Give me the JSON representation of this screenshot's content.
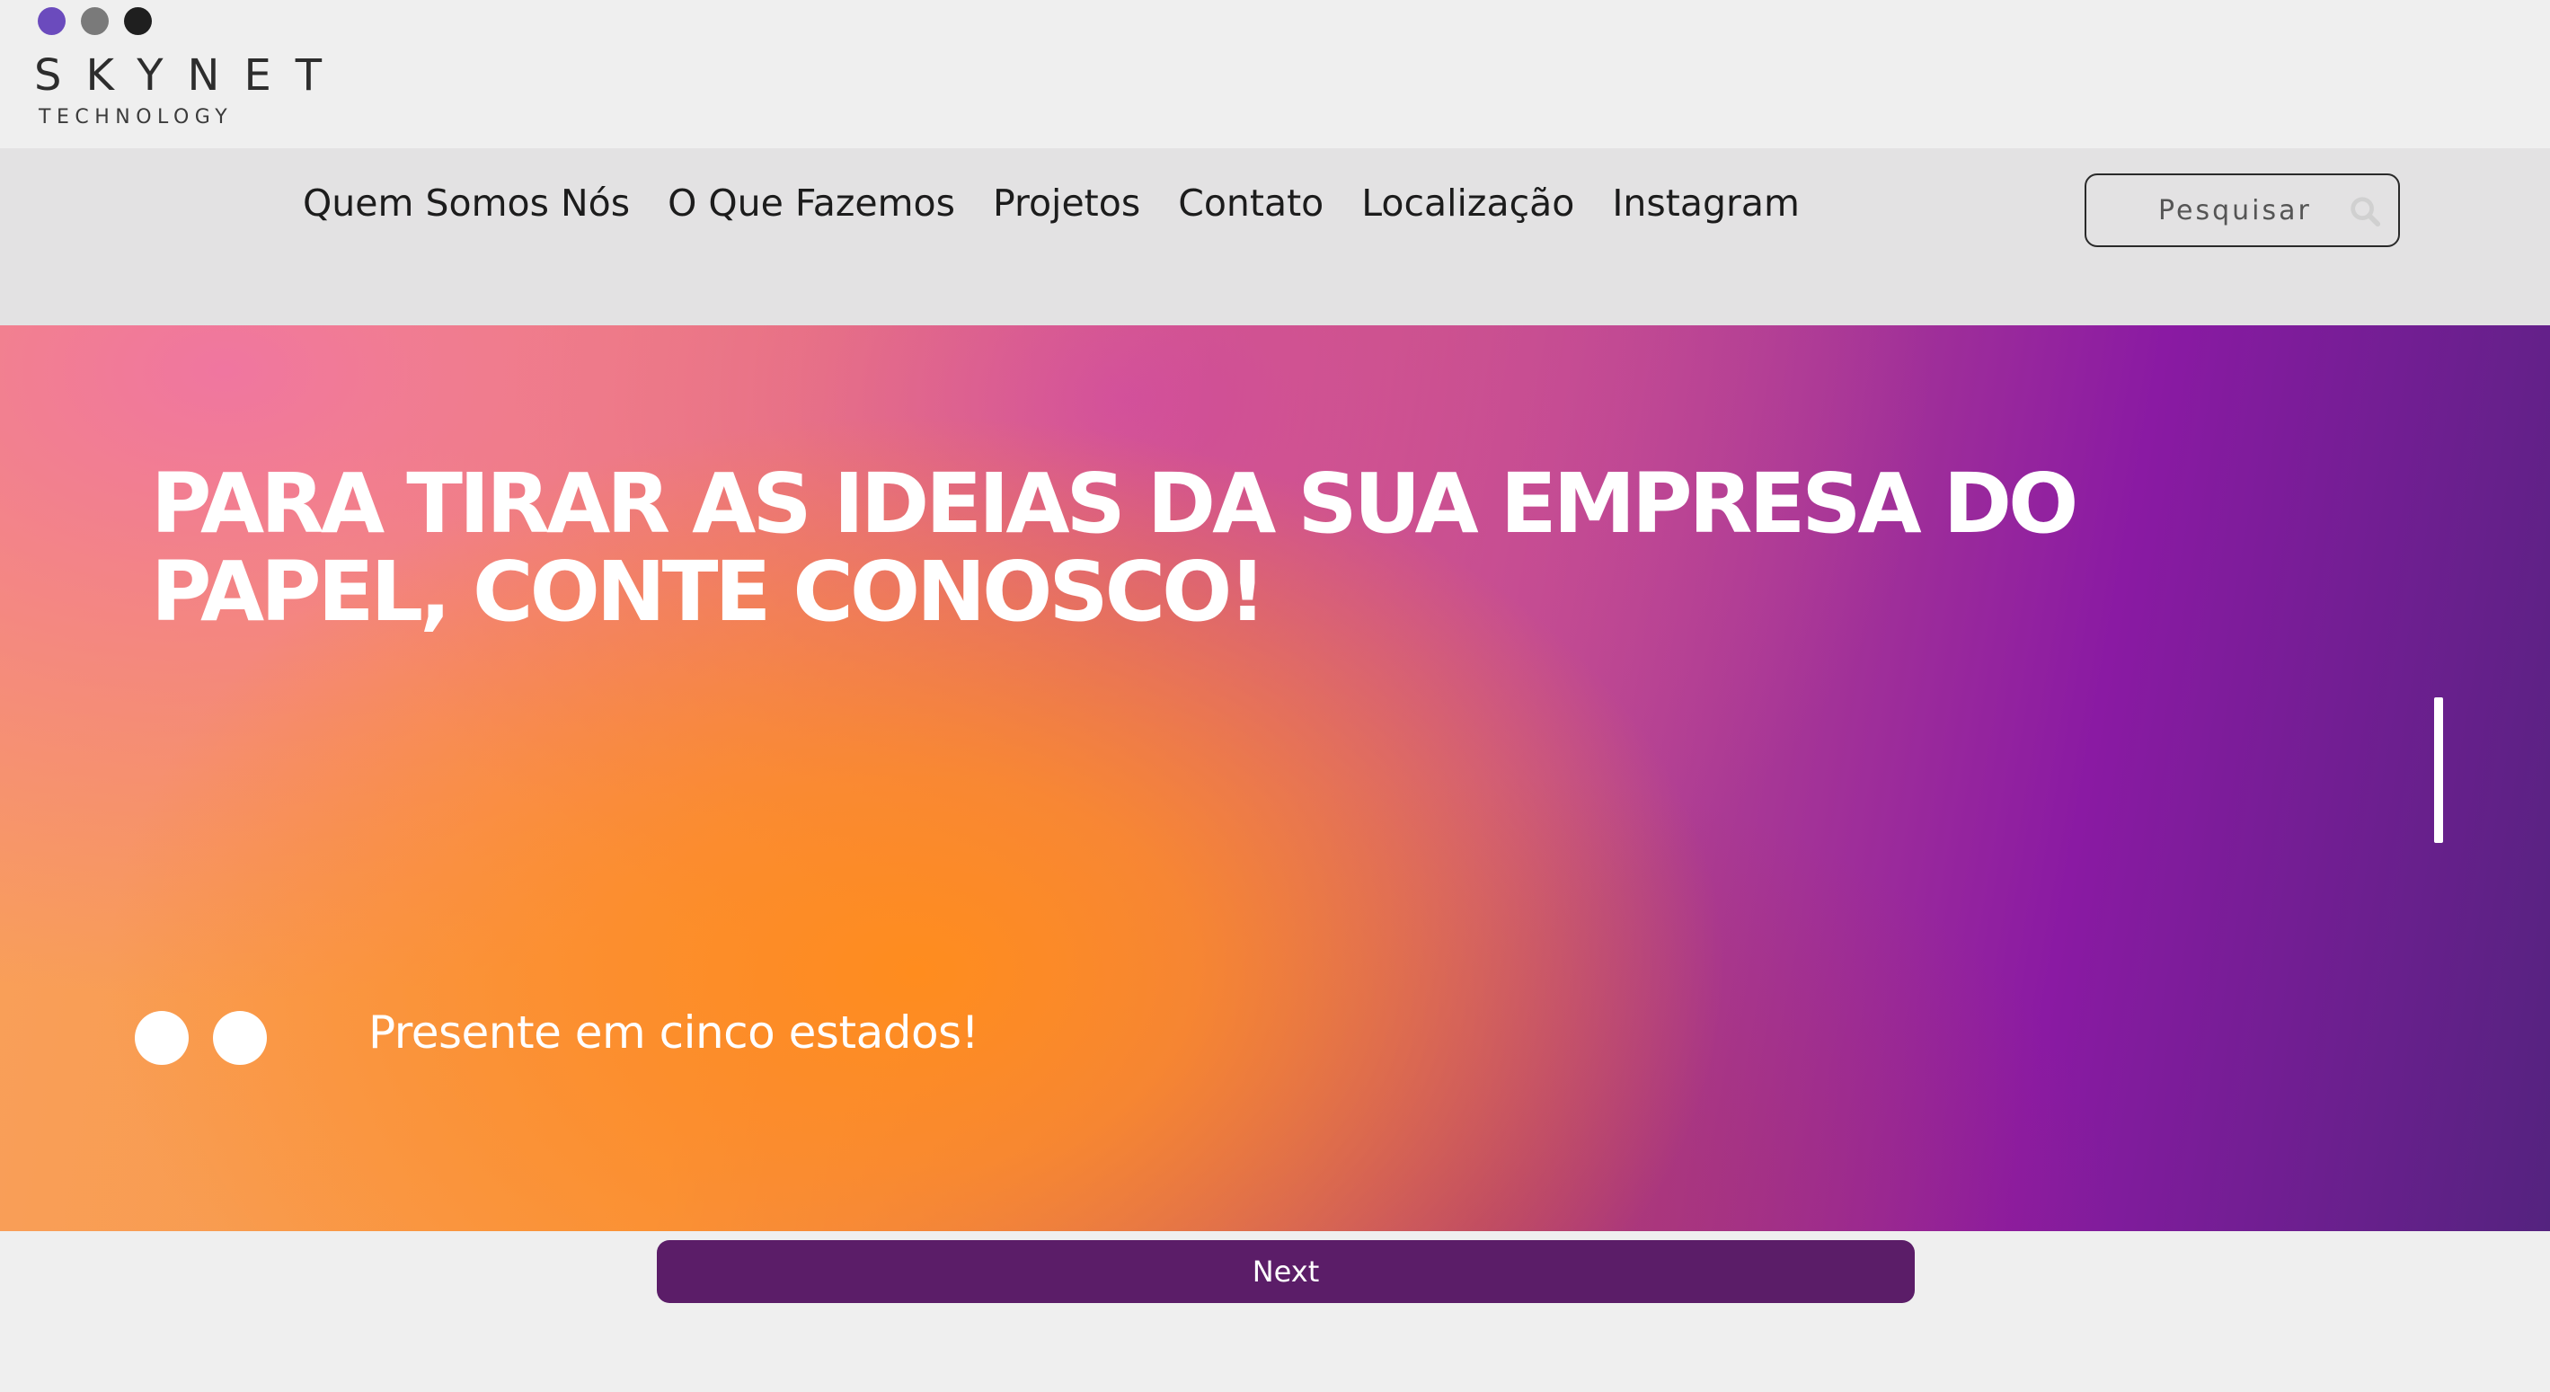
{
  "brand": {
    "name": "SKYNET",
    "tagline": "TECHNOLOGY",
    "dot_colors": [
      "#6b4bbd",
      "#7a7a7a",
      "#1f1f1f"
    ]
  },
  "nav": {
    "items": [
      {
        "label": "Quem Somos Nós"
      },
      {
        "label": "O Que Fazemos"
      },
      {
        "label": "Projetos"
      },
      {
        "label": "Contato"
      },
      {
        "label": "Localização"
      },
      {
        "label": "Instagram"
      }
    ]
  },
  "search": {
    "placeholder": "Pesquisar",
    "icon": "search-icon"
  },
  "hero": {
    "title_line1": "PARA TIRAR AS IDEIAS DA SUA EMPRESA DO",
    "title_line2": "PAPEL, CONTE CONOSCO!",
    "subtitle": "Presente em cinco estados!",
    "slide_count": 2
  },
  "next": {
    "label": "Next"
  },
  "colors": {
    "accent": "#5b1d68",
    "nav_background": "#e3e2e3",
    "page_background": "#efefef"
  }
}
